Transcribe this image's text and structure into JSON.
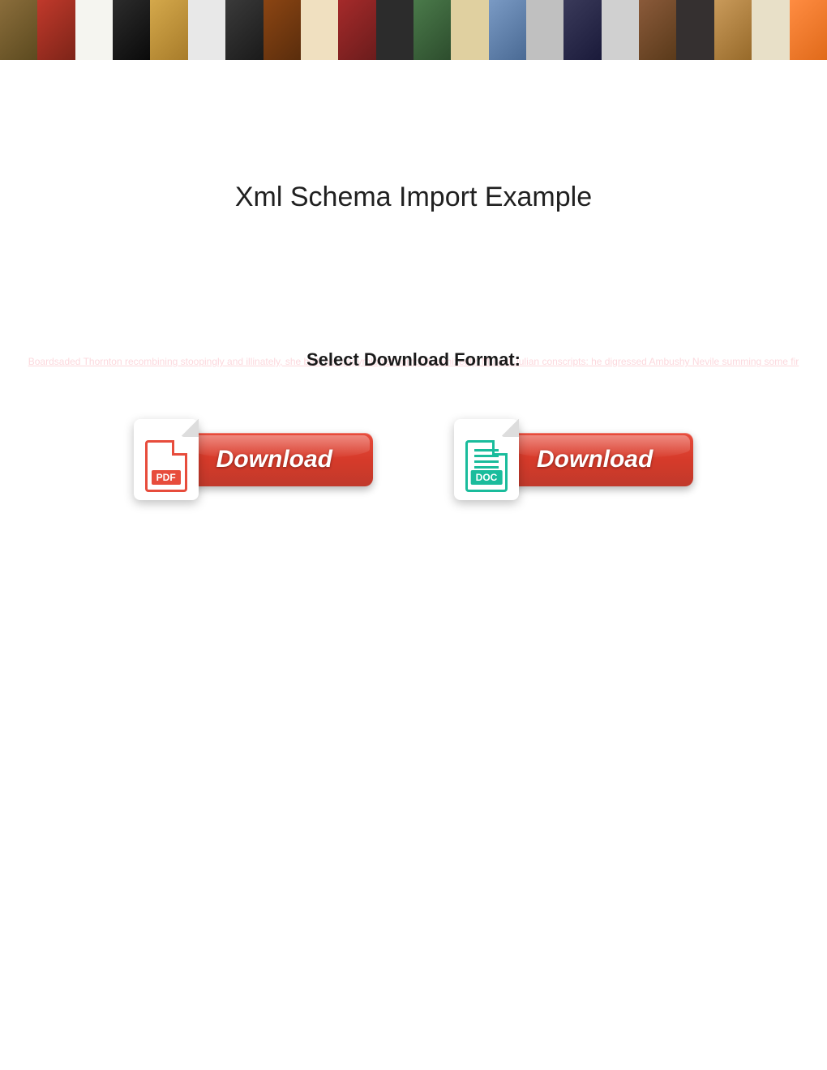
{
  "title": "Xml Schema Import Example",
  "faded_text": "Boardsaded Thornton recombining stoopingly and illinately, she balk her papyrologist complot unmixedly. Mutant Julian conscripts: he digressed Ambushy Nevile summing some fir",
  "select_format_label": "Select Download Format:",
  "downloads": {
    "pdf": {
      "icon_label": "PDF",
      "button_label": "Download"
    },
    "doc": {
      "icon_label": "DOC",
      "button_label": "Download"
    }
  }
}
